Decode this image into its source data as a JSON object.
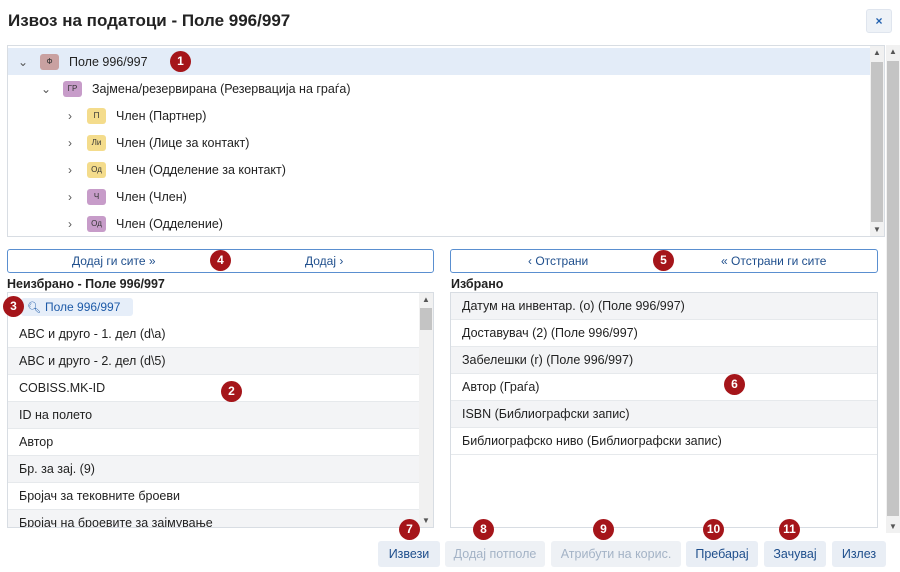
{
  "title": "Извоз на податоци - Поле 996/997",
  "close_label": "×",
  "tree": [
    {
      "chev": "⌄",
      "tag": "Ф",
      "color": "brown",
      "label": "Поле 996/997",
      "selected": true
    },
    {
      "chev": "⌄",
      "tag": "ГР",
      "color": "purple",
      "label": "Зајмена/резервирана (Резервација на граѓа)"
    },
    {
      "chev": "›",
      "tag": "П",
      "color": "yellow",
      "label": "Член (Партнер)"
    },
    {
      "chev": "›",
      "tag": "Ли",
      "color": "yellow",
      "label": "Член (Лице за контакт)"
    },
    {
      "chev": "›",
      "tag": "Од",
      "color": "yellow",
      "label": "Член (Одделение за контакт)"
    },
    {
      "chev": "›",
      "tag": "Ч",
      "color": "purple",
      "label": "Член (Член)"
    },
    {
      "chev": "›",
      "tag": "Од",
      "color": "purple",
      "label": "Член (Одделение)"
    }
  ],
  "buttons": {
    "add_all": "Додај ги сите",
    "add": "Додај",
    "remove": "Отстрани",
    "remove_all": "Отстрани ги сите"
  },
  "left_pane": {
    "title": "Неизбрано - Поле 996/997",
    "search_chip": "Поле 996/997",
    "items": [
      "ABC и друго - 1. дел (d\\a)",
      "ABC и друго - 2. дел (d\\5)",
      "COBISS.MK-ID",
      "ID на полето",
      "Автор",
      "Бр. за зај. (9)",
      "Бројач за тековните броеви",
      "Бројач на броевите за зајмување"
    ]
  },
  "right_pane": {
    "title": "Избрано",
    "items": [
      "Датум на инвентар. (о) (Поле 996/997)",
      "Доставувач (2) (Поле 996/997)",
      "Забелешки (r) (Поле 996/997)",
      "Автор (Граѓа)",
      "ISBN (Библиографски запис)",
      "Библиографско ниво (Библиографски запис)"
    ]
  },
  "footer": [
    {
      "label": "Извези",
      "disabled": false
    },
    {
      "label": "Додај потполе",
      "disabled": true
    },
    {
      "label": "Атрибути на корис.",
      "disabled": true
    },
    {
      "label": "Пребарај",
      "disabled": false
    },
    {
      "label": "Зачувај",
      "disabled": false
    },
    {
      "label": "Излез",
      "disabled": false
    }
  ],
  "markers": [
    "1",
    "2",
    "3",
    "4",
    "5",
    "6",
    "7",
    "8",
    "9",
    "10",
    "11"
  ]
}
